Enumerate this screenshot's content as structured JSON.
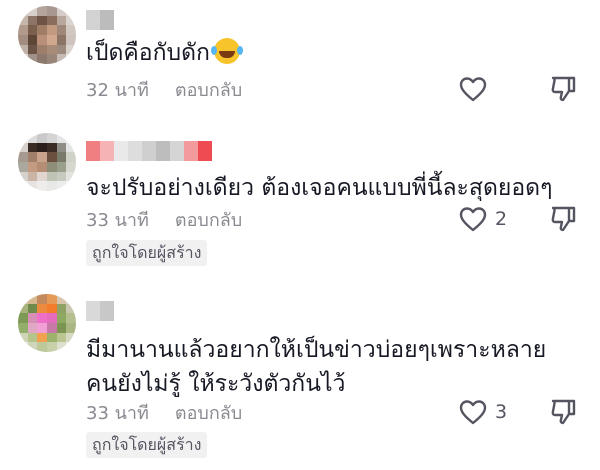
{
  "comments": [
    {
      "text": "เป็ดคือกับดัก",
      "emoji": "laughing-crying-emoji",
      "time": "32 นาที",
      "reply_label": "ตอบกลับ",
      "likes": ""
    },
    {
      "text": "จะปรับอย่างเดียว ต้องเจอคนแบบพี่นี้ละสุดยอดๆ",
      "time": "33 นาที",
      "reply_label": "ตอบกลับ",
      "likes": "2",
      "badge": "ถูกใจโดยผู้สร้าง"
    },
    {
      "text_line1": "มีมานานแล้วอยากให้เป็นข่าวบ่อยๆเพราะหลาย",
      "text_line2": "คนยังไม่รู้ ให้ระวังตัวกันไว้",
      "time": "33 นาที",
      "reply_label": "ตอบกลับ",
      "likes": "3",
      "badge": "ถูกใจโดยผู้สร้าง"
    }
  ],
  "colors": {
    "text": "#161823",
    "muted": "#8a8b91",
    "badge_bg": "#f1f1f2"
  },
  "icons": {
    "like": "heart-outline-icon",
    "dislike": "thumbs-down-outline-icon"
  }
}
